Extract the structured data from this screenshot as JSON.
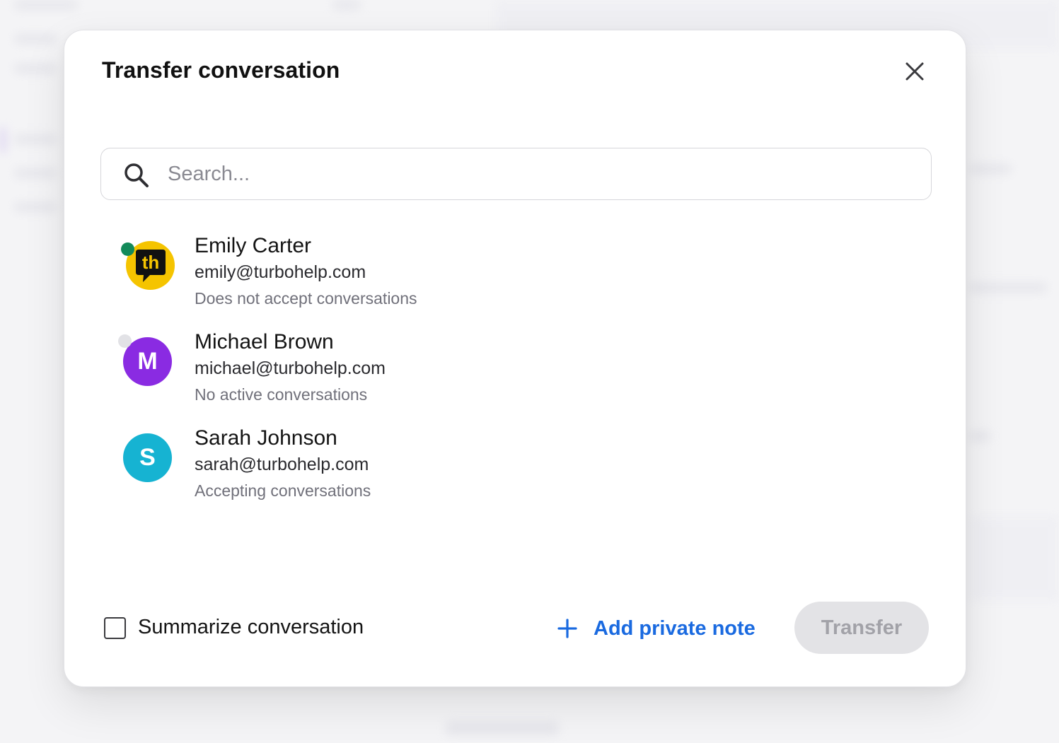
{
  "dialog": {
    "title": "Transfer conversation"
  },
  "search": {
    "placeholder": "Search...",
    "value": ""
  },
  "agents": [
    {
      "name": "Emily Carter",
      "email": "emily@turbohelp.com",
      "status_text": "Does not accept conversations",
      "avatar_text": "th",
      "avatar_type": "logo",
      "avatar_color": "#f5c400",
      "presence_color": "#138a5a"
    },
    {
      "name": "Michael Brown",
      "email": "michael@turbohelp.com",
      "status_text": "No active conversations",
      "avatar_text": "M",
      "avatar_type": "initial",
      "avatar_color": "#8a2be2",
      "presence_color": "#e2e2e6"
    },
    {
      "name": "Sarah Johnson",
      "email": "sarah@turbohelp.com",
      "status_text": "Accepting conversations",
      "avatar_text": "S",
      "avatar_type": "initial",
      "avatar_color": "#16b3d2",
      "presence_color": null
    }
  ],
  "footer": {
    "summarize_label": "Summarize conversation",
    "summarize_checked": false,
    "add_note_label": "Add private note",
    "transfer_label": "Transfer",
    "transfer_enabled": false
  },
  "icons": {
    "close": "close-icon",
    "search": "search-icon",
    "add": "plus-icon"
  },
  "colors": {
    "accent": "#1a6ae0",
    "disabled_button_bg": "#e3e3e6",
    "disabled_button_text": "#a2a2a8"
  }
}
